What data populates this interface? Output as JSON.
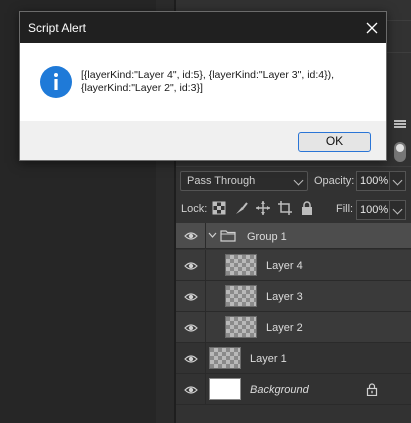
{
  "dialog": {
    "title": "Script Alert",
    "message": "[{layerKind:\"Layer 4\", id:5}, {layerKind:\"Layer 3\", id:4}),\n{layerKind:\"Layer 2\", id:3}]",
    "ok_label": "OK",
    "icon": "info-icon",
    "accent": "#1f7ad8"
  },
  "layers_panel": {
    "blend_mode": "Pass Through",
    "opacity_label": "Opacity:",
    "opacity_value": "100%",
    "lock_label": "Lock:",
    "fill_label": "Fill:",
    "fill_value": "100%",
    "layers": [
      {
        "name": "Group 1",
        "type": "group",
        "expanded": true
      },
      {
        "name": "Layer 4",
        "type": "child"
      },
      {
        "name": "Layer 3",
        "type": "child"
      },
      {
        "name": "Layer 2",
        "type": "child"
      },
      {
        "name": "Layer 1",
        "type": "layer"
      },
      {
        "name": "Background",
        "type": "background",
        "locked": true
      }
    ]
  }
}
